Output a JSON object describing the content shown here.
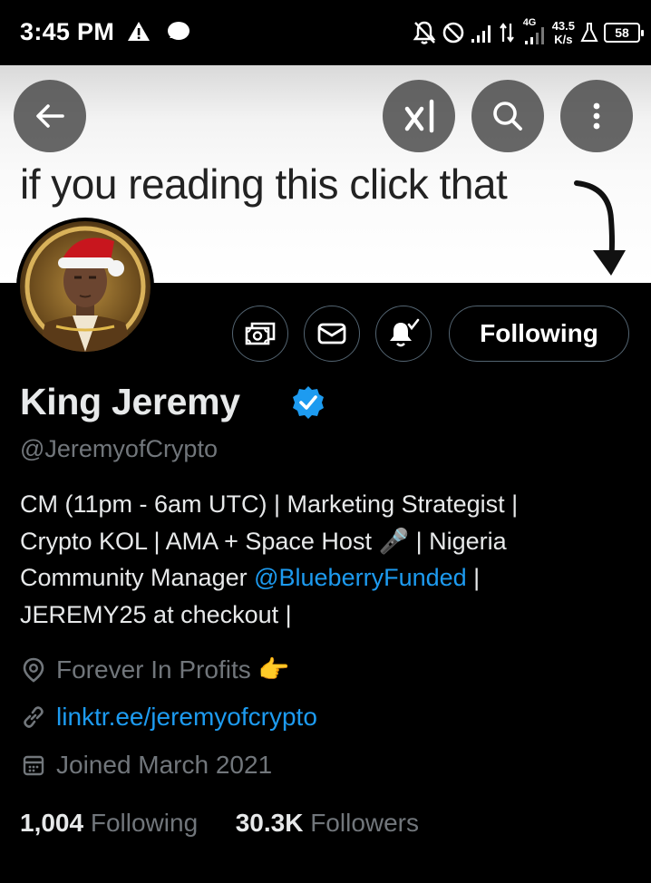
{
  "status_bar": {
    "time": "3:45 PM",
    "network_type": "4G",
    "speed_value": "43.5",
    "speed_unit": "K/s",
    "battery": "58"
  },
  "banner": {
    "text": "if you reading this click that"
  },
  "top_actions": {
    "icons": [
      "back-arrow-icon",
      "grok-icon",
      "search-icon",
      "more-vertical-icon"
    ]
  },
  "profile": {
    "name": "King Jeremy",
    "handle": "@JeremyofCrypto",
    "following_label": "Following",
    "bio": {
      "line1": "CM (11pm - 6am UTC) | Marketing Strategist |",
      "line2_before": "Crypto KOL | AMA + Space Host ",
      "line2_emoji": "🎤",
      "line2_after": " | Nigeria",
      "line3_before": "Community Manager ",
      "line3_mention": "@BlueberryFunded",
      "line3_after": " |",
      "line4": "JEREMY25 at checkout |"
    },
    "location": "Forever In Profits",
    "location_emoji": "👉",
    "website": "linktr.ee/jeremyofcrypto",
    "joined": "Joined March 2021",
    "following_count": "1,004",
    "following_text": "Following",
    "followers_count": "30.3K",
    "followers_text": "Followers"
  },
  "colors": {
    "accent": "#1d9bf0",
    "secondary_text": "#71767b",
    "primary_text": "#e7e9ea",
    "background": "#000000"
  }
}
